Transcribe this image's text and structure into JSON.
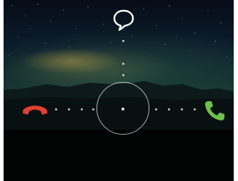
{
  "colors": {
    "decline": "#e2412f",
    "answer": "#6cc24a",
    "ring": "#e6ebeb"
  },
  "icons": {
    "message": "chat-bubble-icon",
    "decline": "phone-hangup-icon",
    "answer": "phone-answer-icon"
  }
}
